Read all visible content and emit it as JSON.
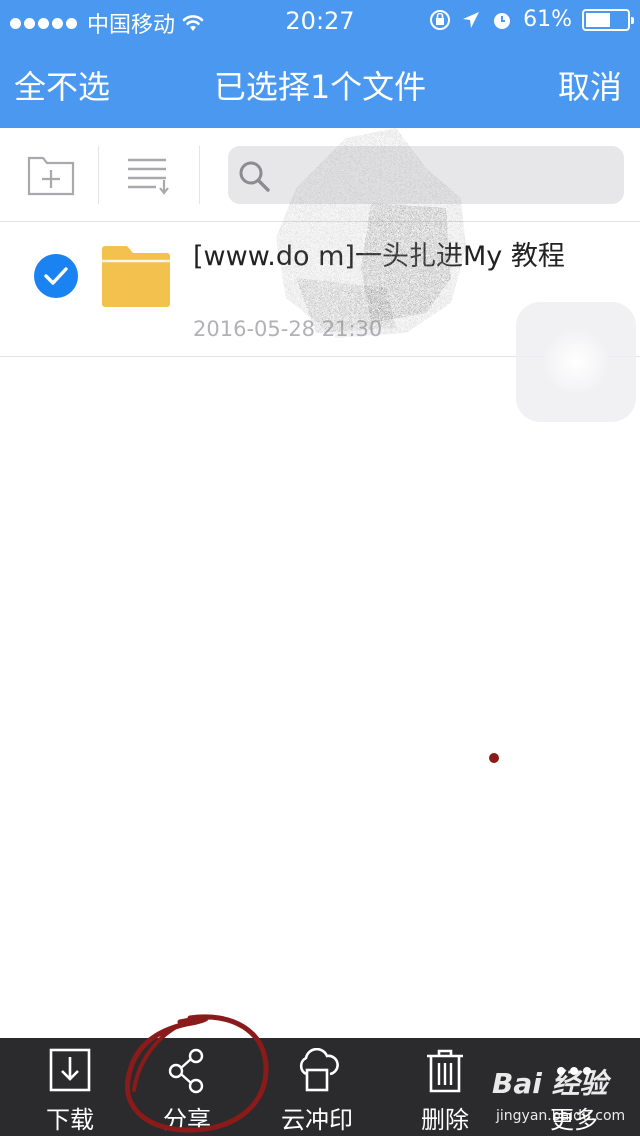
{
  "status_bar": {
    "carrier": "中国移动",
    "time": "20:27",
    "battery_percent": "61%",
    "battery_level": 0.61,
    "icons": [
      "signal-dots-icon",
      "wifi-icon",
      "orientation-lock-icon",
      "location-arrow-icon",
      "alarm-icon",
      "battery-icon"
    ]
  },
  "nav": {
    "left_label": "全不选",
    "title": "已选择1个文件",
    "right_label": "取消"
  },
  "toolbar": {
    "icons": [
      "new-folder-icon",
      "sort-list-icon",
      "search-icon"
    ]
  },
  "files": [
    {
      "name": "[www.do              m]一头扎进My          教程",
      "date": "2016-05-28 21:30",
      "selected": true,
      "icon": "folder-icon"
    }
  ],
  "bottom_bar": {
    "actions": [
      {
        "label": "下载",
        "icon": "download-icon"
      },
      {
        "label": "分享",
        "icon": "share-icon"
      },
      {
        "label": "云冲印",
        "icon": "cloud-print-icon"
      },
      {
        "label": "删除",
        "icon": "trash-icon"
      },
      {
        "label": "更多",
        "icon": "more-icon"
      }
    ]
  },
  "watermark": {
    "brand": "Bai 经验",
    "url": "jingyan.baidu.com"
  },
  "colors": {
    "header_blue": "#4a98ef",
    "check_blue": "#1a82f1",
    "folder_yellow": "#f2c14e",
    "bottom_bar": "#2b2b2d",
    "annotation_red": "#8b1a1a"
  }
}
